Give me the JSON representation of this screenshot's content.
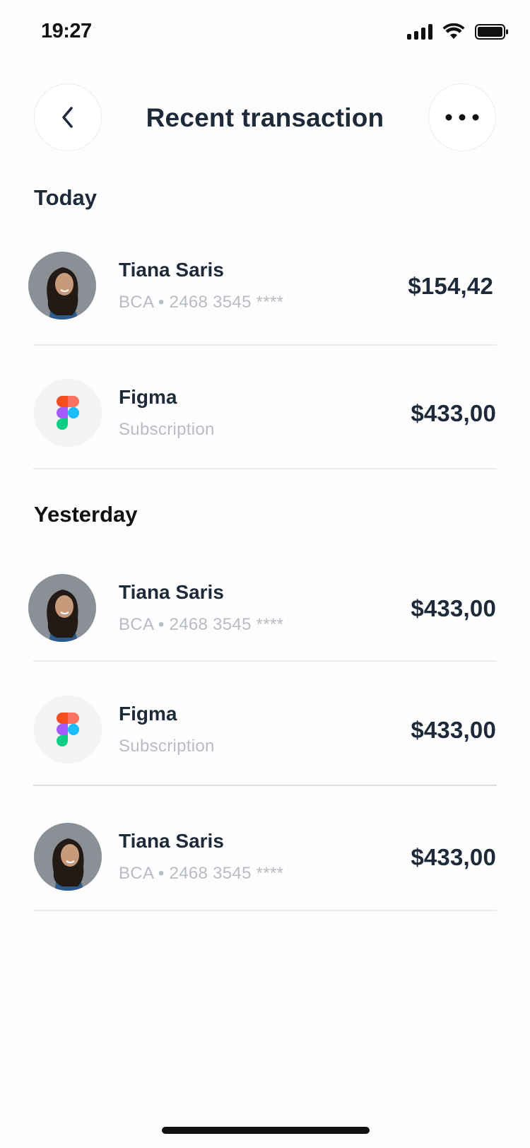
{
  "status_bar": {
    "time": "19:27"
  },
  "header": {
    "title": "Recent transaction",
    "back_icon": "chevron-left-icon",
    "more_icon": "more-horizontal-icon"
  },
  "sections": [
    {
      "title": "Today",
      "items": [
        {
          "name": "Tiana Saris",
          "subtitle": "BCA • 2468 3545 ****",
          "amount": "$154,42",
          "icon": "avatar"
        },
        {
          "name": "Figma",
          "subtitle": "Subscription",
          "amount": "$433,00",
          "icon": "figma-logo-icon"
        }
      ]
    },
    {
      "title": "Yesterday",
      "items": [
        {
          "name": "Tiana Saris",
          "subtitle": "BCA • 2468 3545 ****",
          "amount": "$433,00",
          "icon": "avatar"
        },
        {
          "name": "Figma",
          "subtitle": "Subscription",
          "amount": "$433,00",
          "icon": "figma-logo-icon"
        },
        {
          "name": "Tiana Saris",
          "subtitle": "BCA • 2468 3545 ****",
          "amount": "$433,00",
          "icon": "avatar"
        }
      ]
    }
  ],
  "colors": {
    "text": "#1e2a3a",
    "subtext": "#b7bcc4",
    "divider": "#ececef",
    "figma_red": "#f24e1e",
    "figma_orange": "#ff7262",
    "figma_purple": "#a259ff",
    "figma_blue": "#1abcfe",
    "figma_green": "#0acf83"
  }
}
